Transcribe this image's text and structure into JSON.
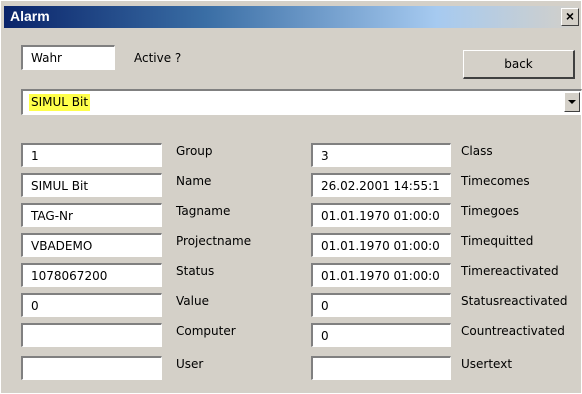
{
  "window": {
    "title": "Alarm",
    "close_glyph": "×",
    "close_icon": "close-icon"
  },
  "top": {
    "active_value": "Wahr",
    "active_label": "Active ?",
    "back_label": "back"
  },
  "selector": {
    "selected": "SIMUL Bit",
    "arrow_icon": "chevron-down-icon",
    "highlight_color": "#ffff4a"
  },
  "left_fields": [
    {
      "value": "1",
      "label": "Group"
    },
    {
      "value": "SIMUL Bit",
      "label": "Name"
    },
    {
      "value": "TAG-Nr",
      "label": "Tagname"
    },
    {
      "value": "VBADEMO",
      "label": "Projectname"
    },
    {
      "value": "1078067200",
      "label": "Status"
    },
    {
      "value": "0",
      "label": "Value"
    },
    {
      "value": "",
      "label": "Computer"
    },
    {
      "value": "",
      "label": "User"
    }
  ],
  "right_fields": [
    {
      "value": "3",
      "label": "Class"
    },
    {
      "value": "26.02.2001 14:55:1",
      "label": "Timecomes"
    },
    {
      "value": "01.01.1970 01:00:0",
      "label": "Timegoes"
    },
    {
      "value": "01.01.1970 01:00:0",
      "label": "Timequitted"
    },
    {
      "value": "01.01.1970 01:00:0",
      "label": "Timereactivated"
    },
    {
      "value": "0",
      "label": "Statusreactivated"
    },
    {
      "value": "0",
      "label": "Countreactivated"
    },
    {
      "value": "",
      "label": "Usertext"
    }
  ]
}
